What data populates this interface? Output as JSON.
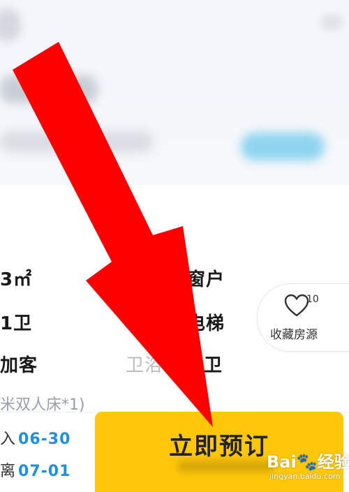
{
  "room_features": {
    "area": "3㎡",
    "window": "窗户",
    "bath": "1卫",
    "elevator": "电梯",
    "extra_bed": "加客",
    "bathroom_faded": "卫浴",
    "bathroom_type": "卫",
    "bed_info": "米双人床*1)"
  },
  "favorite": {
    "count": "10",
    "label": "收藏房源",
    "icon": "heart-icon"
  },
  "booking": {
    "checkin_prefix": "入",
    "checkin_date": "06-30",
    "checkout_prefix": "离",
    "checkout_date": "07-01",
    "book_label": "立即预订"
  },
  "watermark": {
    "brand": "Bai",
    "brand_cn": "经验",
    "url": "jingyan.baidu.com"
  },
  "colors": {
    "book_button": "#fec70a",
    "date_text": "#1e90e0",
    "arrow": "#ff0000"
  }
}
